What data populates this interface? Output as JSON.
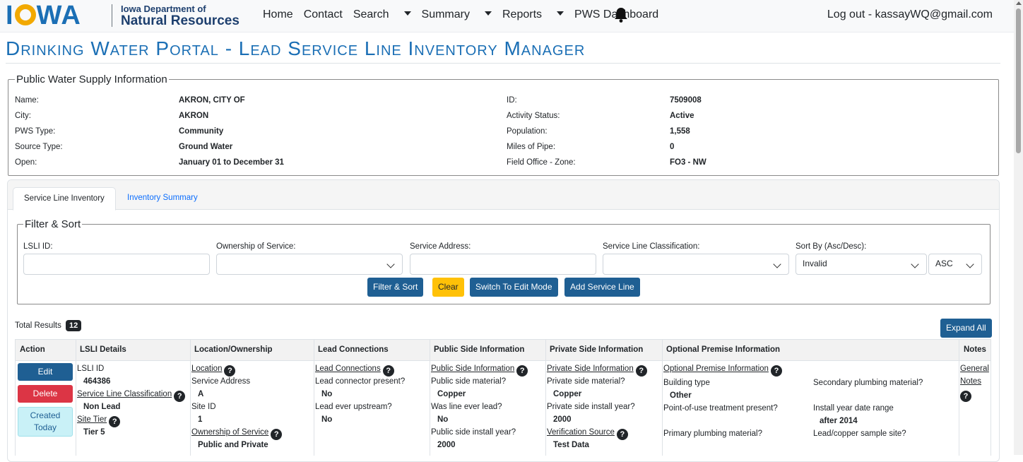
{
  "nav": {
    "logo_text": "IOWA",
    "org_line1": "Iowa Department of",
    "org_line2": "Natural Resources",
    "links": [
      "Home",
      "Contact",
      "Search",
      "Summary",
      "Reports",
      "PWS Dashboard"
    ],
    "logout": "Log out - kassayWQ@gmail.com"
  },
  "page_title": "Drinking Water Portal - Lead Service Line Inventory Manager",
  "pws": {
    "legend": "Public Water Supply Information",
    "left": [
      {
        "label": "Name:",
        "value": "AKRON, CITY OF"
      },
      {
        "label": "City:",
        "value": "AKRON"
      },
      {
        "label": "PWS Type:",
        "value": "Community"
      },
      {
        "label": "Source Type:",
        "value": "Ground Water"
      },
      {
        "label": "Open:",
        "value": "January 01 to December 31"
      }
    ],
    "right": [
      {
        "label": "ID:",
        "value": "7509008"
      },
      {
        "label": "Activity Status:",
        "value": "Active"
      },
      {
        "label": "Population:",
        "value": "1,558"
      },
      {
        "label": "Miles of Pipe:",
        "value": "0"
      },
      {
        "label": "Field Office - Zone:",
        "value": "FO3 - NW"
      }
    ]
  },
  "tabs": [
    "Service Line Inventory",
    "Inventory Summary"
  ],
  "filter": {
    "legend": "Filter & Sort",
    "labels": {
      "lsli_id": "LSLI ID:",
      "ownership": "Ownership of Service:",
      "address": "Service Address:",
      "classification": "Service Line Classification:",
      "sort_by": "Sort By (Asc/Desc):"
    },
    "sort_by_value": "Invalid",
    "sort_dir_value": "ASC",
    "buttons": {
      "filter_sort": "Filter & Sort",
      "clear": "Clear",
      "edit_mode": "Switch To Edit Mode",
      "add": "Add Service Line"
    }
  },
  "results": {
    "label": "Total Results",
    "count": "12",
    "expand_all": "Expand All"
  },
  "table": {
    "headers": [
      "Action",
      "LSLI Details",
      "Location/Ownership",
      "Lead Connections",
      "Public Side Information",
      "Private Side Information",
      "Optional Premise Information",
      "Notes"
    ],
    "actions": {
      "edit": "Edit",
      "delete": "Delete",
      "created_line1": "Created",
      "created_line2": "Today"
    },
    "details": {
      "id_label": "LSLI ID",
      "id_value": "464386",
      "class_link": "Service Line Classification",
      "class_value": "Non Lead",
      "tier_link": "Site Tier",
      "tier_value": "Tier 5"
    },
    "location": {
      "link": "Location",
      "addr_label": "Service Address",
      "addr_value": "A",
      "site_label": "Site ID",
      "site_value": "1",
      "own_link": "Ownership of Service",
      "own_value": "Public and Private"
    },
    "lead": {
      "link": "Lead Connections",
      "q1": "Lead connector present?",
      "a1": "No",
      "q2": "Lead ever upstream?",
      "a2": "No"
    },
    "public": {
      "link": "Public Side Information",
      "q1": "Public side material?",
      "a1": "Copper",
      "q2": "Was line ever lead?",
      "a2": "No",
      "q3": "Public side install year?",
      "a3": "2000"
    },
    "private": {
      "link": "Private Side Information",
      "q1": "Private side material?",
      "a1": "Copper",
      "q2": "Private side install year?",
      "a2": "2000",
      "ver_link": "Verification Source",
      "ver_value": "Test Data"
    },
    "premise": {
      "link": "Optional Premise Information",
      "building_label": "Building type",
      "building_value": "Other",
      "pou_label": "Point-of-use treatment present?",
      "primary_label": "Primary plumbing material?",
      "secondary_label": "Secondary plumbing material?",
      "install_label": "Install year date range",
      "install_value": "after 2014",
      "sample_label": "Lead/copper sample site?"
    },
    "notes": {
      "line1": "General",
      "line2": "Notes"
    }
  },
  "colors": {
    "brand_blue": "#1b6fb5",
    "button_blue": "#1f5f93",
    "delete_red": "#dc3545",
    "clear_yellow": "#ffc107",
    "created_cyan": "#c9f1f7"
  }
}
